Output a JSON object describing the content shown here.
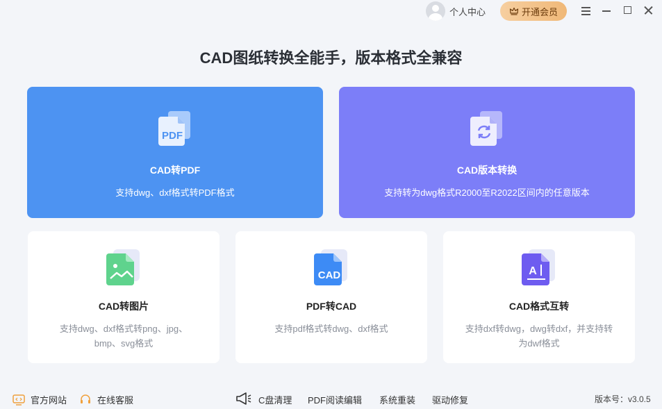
{
  "header": {
    "user_label": "个人中心",
    "vip_label": "开通会员"
  },
  "headline": "CAD图纸转换全能手，版本格式全兼容",
  "feature_cards": [
    {
      "title": "CAD转PDF",
      "desc": "支持dwg、dxf格式转PDF格式",
      "icon": "pdf-file-icon",
      "icon_text": "PDF",
      "color": "#4d93f2"
    },
    {
      "title": "CAD版本转换",
      "desc": "支持转为dwg格式R2000至R2022区间内的任意版本",
      "icon": "version-convert-icon",
      "color": "#7c7ef8"
    }
  ],
  "tool_cards": [
    {
      "title": "CAD转图片",
      "desc": "支持dwg、dxf格式转png、jpg、bmp、svg格式",
      "icon": "image-file-icon",
      "color": "#5fd38d"
    },
    {
      "title": "PDF转CAD",
      "desc": "支持pdf格式转dwg、dxf格式",
      "icon": "cad-file-icon",
      "icon_text": "CAD",
      "color": "#3d8bf5"
    },
    {
      "title": "CAD格式互转",
      "desc": "支持dxf转dwg，dwg转dxf，并支持转为dwf格式",
      "icon": "format-text-icon",
      "icon_text": "A",
      "color": "#6e5cf0"
    }
  ],
  "footer": {
    "official_site": "官方网站",
    "online_service": "在线客服",
    "links": [
      "C盘清理",
      "PDF阅读编辑",
      "系统重装",
      "驱动修复"
    ],
    "version": "版本号：v3.0.5"
  }
}
